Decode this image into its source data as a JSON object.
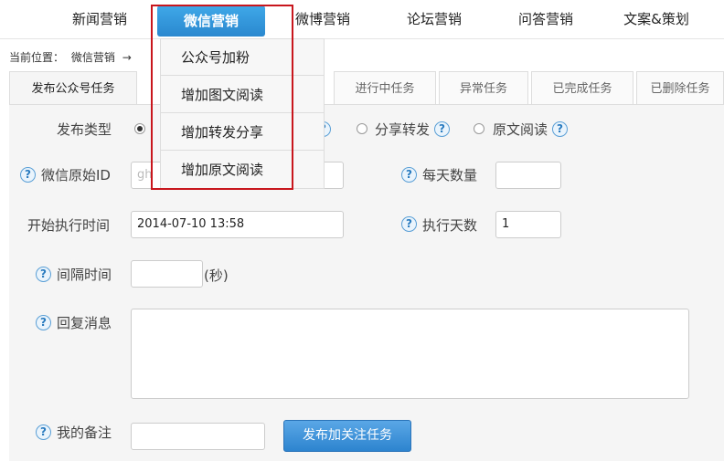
{
  "nav": {
    "items": [
      "新闻营销",
      "微信营销",
      "微博营销",
      "论坛营销",
      "问答营销",
      "文案&策划"
    ],
    "active": "微信营销"
  },
  "breadcrumb": {
    "prefix": "当前位置：",
    "section": "微信营销",
    "arrow": "→"
  },
  "tabs": [
    "发布公众号任务",
    "进行中任务",
    "异常任务",
    "已完成任务",
    "已删除任务"
  ],
  "dropdown": {
    "items": [
      "公众号加粉",
      "增加图文阅读",
      "增加转发分享",
      "增加原文阅读"
    ]
  },
  "form": {
    "publish_type_label": "发布类型",
    "publish_options": [
      "分享转发",
      "原文阅读"
    ],
    "wechat_id_label": "微信原始ID",
    "wechat_id_placeholder": "gh",
    "daily_count_label": "每天数量",
    "daily_count_value": "",
    "start_time_label": "开始执行时间",
    "start_time_value": "2014-07-10 13:58",
    "exec_days_label": "执行天数",
    "exec_days_value": "1",
    "interval_label": "间隔时间",
    "interval_value": "",
    "interval_unit": "(秒)",
    "reply_label": "回复消息",
    "reply_value": "",
    "remark_label": "我的备注",
    "remark_value": "",
    "submit_label": "发布加关注任务"
  },
  "icons": {
    "help": "?"
  },
  "colors": {
    "accent": "#2a88cf",
    "highlight": "#c8161d"
  }
}
